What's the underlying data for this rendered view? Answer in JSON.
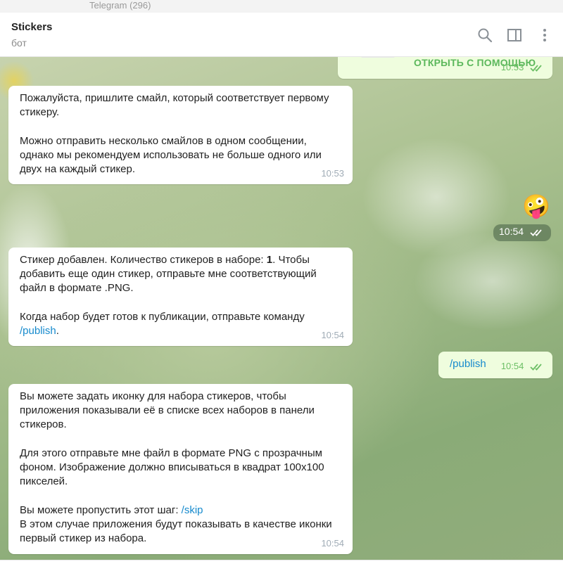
{
  "window": {
    "title": "Telegram (296)"
  },
  "header": {
    "name": "Stickers",
    "status": "бот"
  },
  "messages": {
    "m0": {
      "button": "ОТКРЫТЬ С ПОМОЩЬЮ",
      "time": "10:53"
    },
    "m1": {
      "p1": "Пожалуйста, пришлите смайл, который соответствует первому стикеру.",
      "p2": "Можно отправить несколько смайлов в одном сообщении, однако мы рекомендуем использовать не больше одного или двух на каждый стикер.",
      "time": "10:53"
    },
    "m2": {
      "emoji": "🤪",
      "time": "10:54"
    },
    "m3": {
      "p1_a": "Стикер добавлен. Количество стикеров в наборе: ",
      "p1_bold": "1",
      "p1_b": ". Чтобы добавить еще один стикер, отправьте мне соответствующий файл в формате .PNG.",
      "p2_a": "Когда набор будет готов к публикации, отправьте команду ",
      "p2_link": "/publish",
      "p2_b": ".",
      "time": "10:54"
    },
    "m4": {
      "text": "/publish",
      "time": "10:54"
    },
    "m5": {
      "p1": "Вы можете задать иконку для набора стикеров, чтобы приложения показывали её в списке всех наборов в панели стикеров.",
      "p2": "Для этого отправьте мне файл в формате PNG с прозрачным фоном. Изображение должно вписываться в квадрат 100x100 пикселей.",
      "p3_a": "Вы можете пропустить этот шаг: ",
      "p3_link": "/skip",
      "p3_b": "В этом случае приложения будут показывать в качестве иконки первый стикер из набора.",
      "time": "10:54"
    }
  },
  "icons": [
    "search-icon",
    "sidebar-toggle-icon",
    "more-vertical-icon",
    "read-receipt-icon"
  ],
  "colors": {
    "link": "#168acd",
    "outgoing_bubble": "#effdde",
    "outgoing_time": "#6cbf65"
  }
}
